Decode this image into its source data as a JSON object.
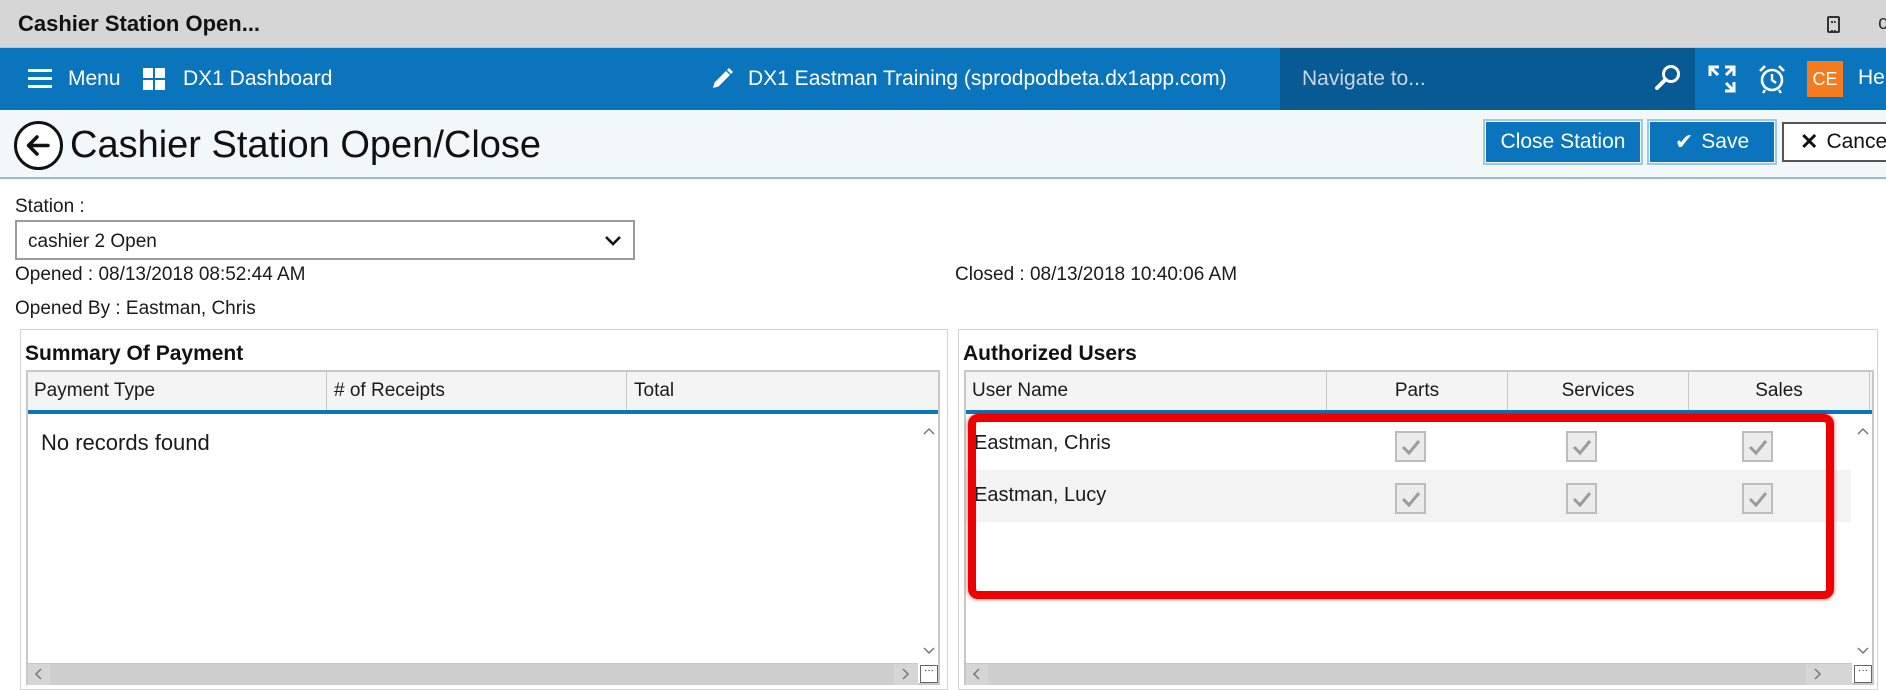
{
  "window": {
    "title": "Cashier Station Open...",
    "edge_char": "c"
  },
  "navbar": {
    "menu_label": "Menu",
    "dashboard_label": "DX1 Dashboard",
    "center_title": "DX1 Eastman Training (sprodpodbeta.dx1app.com)",
    "search_placeholder": "Navigate to...",
    "avatar_initials": "CE",
    "help_label": "Hel",
    "icons": [
      "hamburger-icon",
      "grid-icon",
      "pencil-icon",
      "search-icon",
      "expand-icon",
      "alarm-clock-icon"
    ],
    "bar_color": "#0a74bd",
    "avatar_color": "#f47b20"
  },
  "page": {
    "title": "Cashier Station Open/Close",
    "buttons": {
      "close_station": "Close Station",
      "save": "Save",
      "cancel": "Cancel"
    }
  },
  "station": {
    "label": "Station :",
    "selected": "cashier 2 Open",
    "opened": "Opened : 08/13/2018 08:52:44 AM",
    "closed": "Closed : 08/13/2018 10:40:06 AM",
    "opened_by": "Opened By : Eastman, Chris"
  },
  "summary": {
    "title": "Summary Of Payment",
    "columns": [
      "Payment Type",
      "# of Receipts",
      "Total"
    ],
    "empty_message": "No records found"
  },
  "authorized": {
    "title": "Authorized Users",
    "columns": [
      "User Name",
      "Parts",
      "Services",
      "Sales"
    ],
    "rows": [
      {
        "name": "Eastman, Chris",
        "parts": true,
        "services": true,
        "sales": true
      },
      {
        "name": "Eastman, Lucy",
        "parts": true,
        "services": true,
        "sales": true
      }
    ],
    "highlight_color": "#ee0000"
  }
}
